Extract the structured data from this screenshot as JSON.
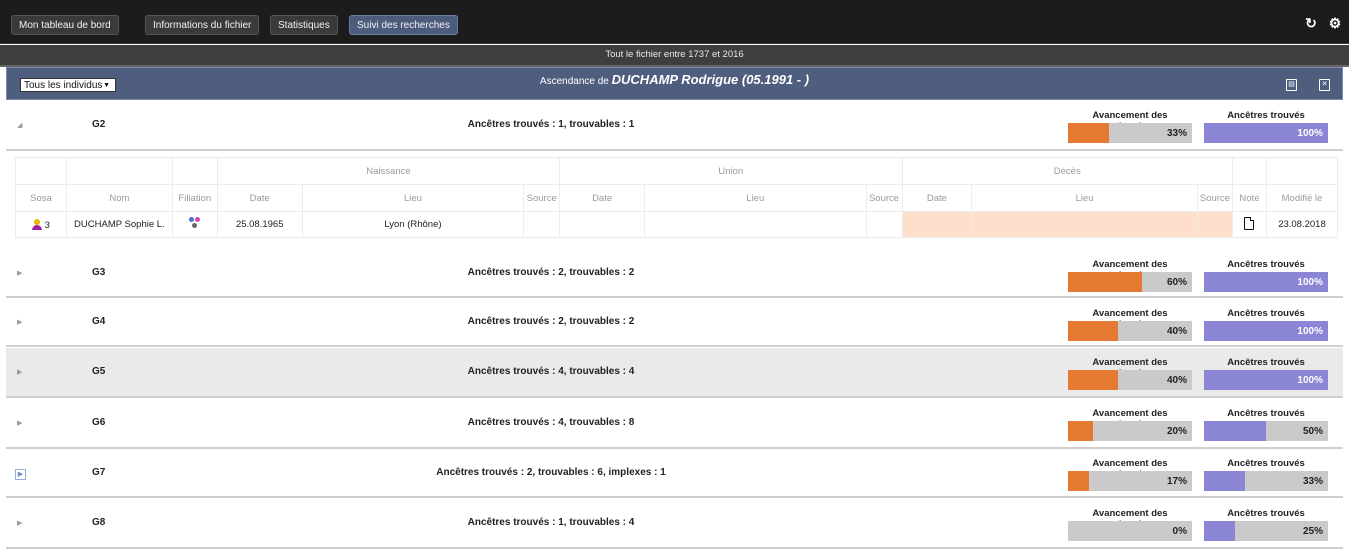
{
  "nav": {
    "tabs": [
      {
        "label": "Mon tableau de bord",
        "active": false
      },
      {
        "label": "Informations du fichier",
        "active": false
      },
      {
        "label": "Statistiques",
        "active": false
      },
      {
        "label": "Suivi des recherches",
        "active": true
      }
    ],
    "icons": [
      "refresh-icon",
      "settings-icon"
    ]
  },
  "subtitle": "Tout le fichier entre 1737 et 2016",
  "header": {
    "select_value": "Tous les individus",
    "title_prefix": "Ascendance de",
    "title_person": "DUCHAMP Rodrigue (05.1991 - )",
    "icons": [
      "pdf-export-icon",
      "excel-export-icon"
    ]
  },
  "meter_labels": {
    "progress": "Avancement des recherches",
    "found": "Ancêtres trouvés"
  },
  "colors": {
    "progress": "#e57a32",
    "found": "#8a85d4",
    "deces_cell": "#fddfcc",
    "header": "#4f5e7e"
  },
  "generations": [
    {
      "label": "G2",
      "summary": "Ancêtres trouvés : 1, trouvables : 1",
      "progress": 33,
      "progress_label": "33%",
      "found": 100,
      "found_label": "100%",
      "expanded": true
    },
    {
      "label": "G3",
      "summary": "Ancêtres trouvés : 2, trouvables : 2",
      "progress": 60,
      "progress_label": "60%",
      "found": 100,
      "found_label": "100%"
    },
    {
      "label": "G4",
      "summary": "Ancêtres trouvés : 2, trouvables : 2",
      "progress": 40,
      "progress_label": "40%",
      "found": 100,
      "found_label": "100%"
    },
    {
      "label": "G5",
      "summary": "Ancêtres trouvés : 4, trouvables : 4",
      "progress": 40,
      "progress_label": "40%",
      "found": 100,
      "found_label": "100%",
      "highlighted": true
    },
    {
      "label": "G6",
      "summary": "Ancêtres trouvés : 4, trouvables : 8",
      "progress": 20,
      "progress_label": "20%",
      "found": 50,
      "found_label": "50%"
    },
    {
      "label": "G7",
      "summary": "Ancêtres trouvés : 2, trouvables : 6, implexes : 1",
      "progress": 17,
      "progress_label": "17%",
      "found": 33,
      "found_label": "33%",
      "boxed_toggle": true
    },
    {
      "label": "G8",
      "summary": "Ancêtres trouvés : 1, trouvables : 4",
      "progress": 0,
      "progress_label": "0%",
      "found": 25,
      "found_label": "25%"
    }
  ],
  "detail_table": {
    "groups": {
      "naissance": "Naissance",
      "union": "Union",
      "deces": "Décès"
    },
    "columns": {
      "sosa": "Sosa",
      "nom": "Nom",
      "filiation": "Filiation",
      "date": "Date",
      "lieu": "Lieu",
      "source": "Source",
      "note": "Note",
      "modifie": "Modifié le"
    },
    "rows": [
      {
        "sosa": "3",
        "nom": "DUCHAMP Sophie L.",
        "naissance_date": "25.08.1965",
        "naissance_lieu": "Lyon (Rhône)",
        "naissance_source": "",
        "union_date": "",
        "union_lieu": "",
        "union_source": "",
        "deces_date": "",
        "deces_lieu": "",
        "deces_source": "",
        "modifie": "23.08.2018"
      }
    ]
  }
}
